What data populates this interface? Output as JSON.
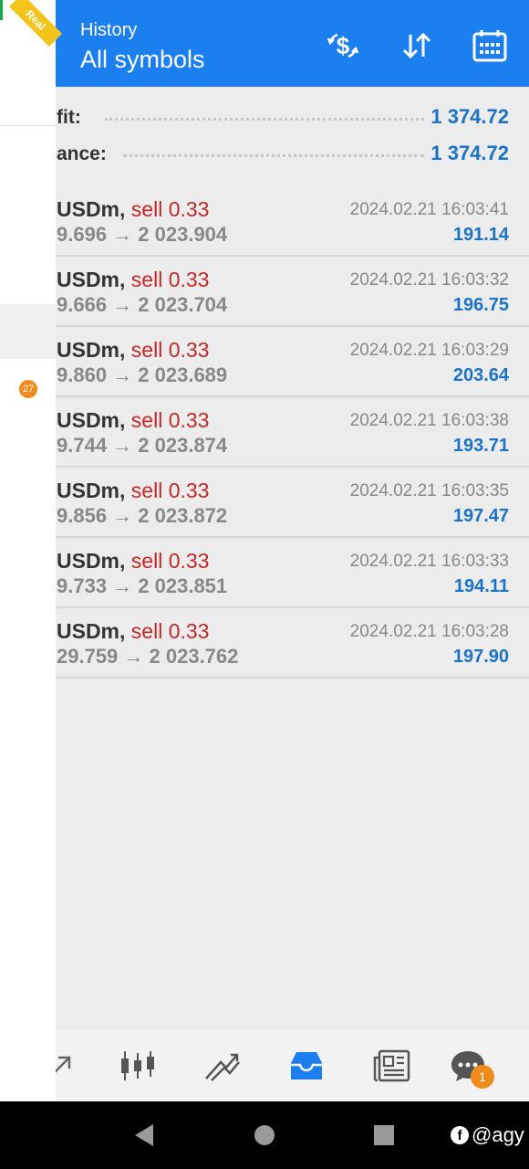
{
  "header": {
    "subtitle": "History",
    "title": "All symbols"
  },
  "summary": {
    "profit_label": "fit:",
    "profit_value": "1 374.72",
    "balance_label": "ance:",
    "balance_value": "1 374.72"
  },
  "trades": [
    {
      "symbol": "USDm,",
      "side": "sell 0.33",
      "prices": "9.696 → 2 023.904",
      "time": "2024.02.21 16:03:41",
      "profit": "191.14"
    },
    {
      "symbol": "USDm,",
      "side": "sell 0.33",
      "prices": "9.666 → 2 023.704",
      "time": "2024.02.21 16:03:32",
      "profit": "196.75"
    },
    {
      "symbol": "USDm,",
      "side": "sell 0.33",
      "prices": "9.860 → 2 023.689",
      "time": "2024.02.21 16:03:29",
      "profit": "203.64"
    },
    {
      "symbol": "USDm,",
      "side": "sell 0.33",
      "prices": "9.744 → 2 023.874",
      "time": "2024.02.21 16:03:38",
      "profit": "193.71"
    },
    {
      "symbol": "USDm,",
      "side": "sell 0.33",
      "prices": "9.856 → 2 023.872",
      "time": "2024.02.21 16:03:35",
      "profit": "197.47"
    },
    {
      "symbol": "USDm,",
      "side": "sell 0.33",
      "prices": "9.733 → 2 023.851",
      "time": "2024.02.21 16:03:33",
      "profit": "194.11"
    },
    {
      "symbol": "USDm,",
      "side": "sell 0.33",
      "prices": "29.759 → 2 023.762",
      "time": "2024.02.21 16:03:28",
      "profit": "197.90"
    }
  ],
  "drawer": {
    "ribbon": "Real",
    "badge": "27"
  },
  "nav": {
    "chat_badge": "1",
    "active": "history-icon"
  },
  "watermark": "@agy",
  "colors": {
    "accent": "#1b7ff0",
    "profit": "#1a73c9",
    "sell": "#c62828",
    "badge": "#f08c1e"
  }
}
